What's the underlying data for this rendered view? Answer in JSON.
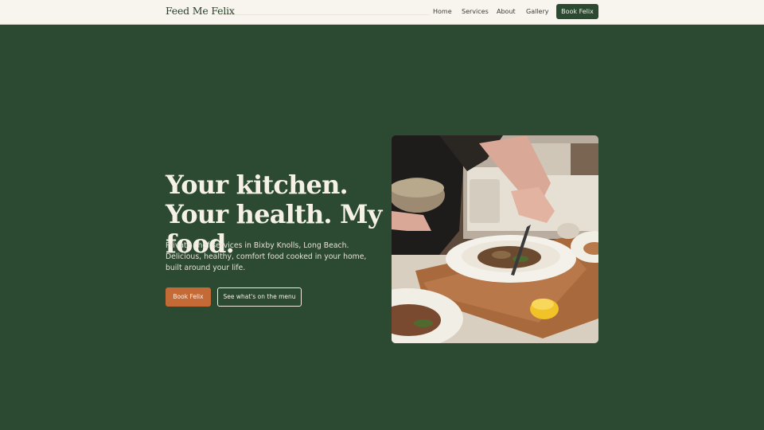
{
  "nav": {
    "brand": "Feed Me Felix",
    "links": [
      {
        "label": "Home"
      },
      {
        "label": "Services"
      },
      {
        "label": "About"
      },
      {
        "label": "Gallery"
      }
    ],
    "cta_label": "Book Felix"
  },
  "hero": {
    "title": "Your kitchen. Your health. My food.",
    "subtitle": "Private chef services in Bixby Knolls, Long Beach. Delicious, healthy, comfort food cooked in your home, built around your life.",
    "primary_button": "Book Felix",
    "secondary_button": "See what's on the menu"
  },
  "colors": {
    "background": "#2c4a32",
    "nav_background": "#f8f5ef",
    "accent": "#c46a36",
    "text_light": "#f5f1e7"
  }
}
